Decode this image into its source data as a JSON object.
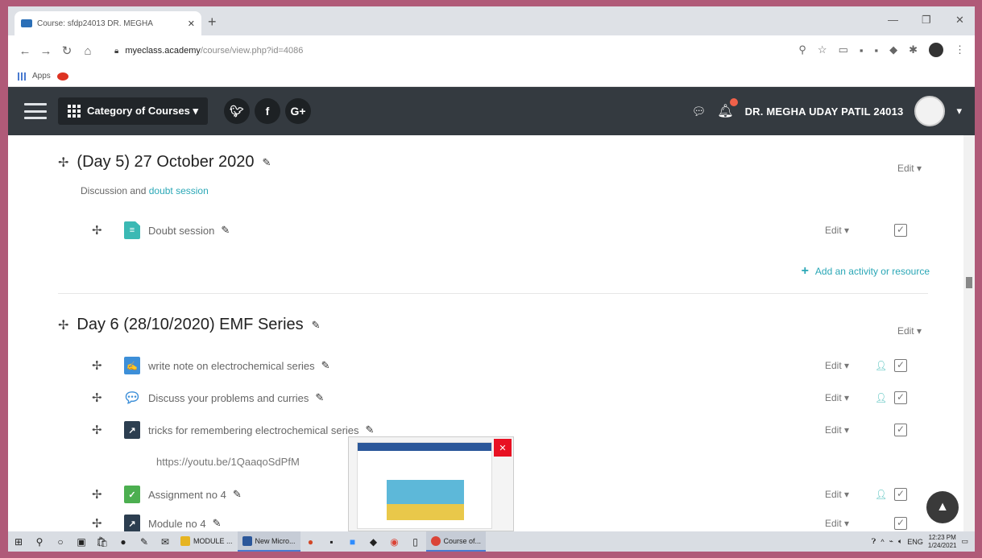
{
  "browser": {
    "tab_title": "Course: sfdp24013 DR. MEGHA",
    "url_host": "myeclass.academy",
    "url_path": "/course/view.php?id=4086",
    "bookmarks_apps": "Apps"
  },
  "navbar": {
    "category_menu": "Category of Courses ▾",
    "social": [
      "𝑲",
      "f",
      "G+"
    ],
    "username": "DR. MEGHA UDAY PATIL 24013"
  },
  "sections": [
    {
      "title": "(Day 5) 27 October 2020",
      "edit": "Edit ▾",
      "summary_text": "Discussion and ",
      "summary_link": "doubt session",
      "activities": [
        {
          "name": "Doubt session",
          "edit": "Edit ▾"
        }
      ],
      "add_activity": "Add an activity or resource"
    },
    {
      "title": "Day 6 (28/10/2020) EMF Series",
      "edit": "Edit ▾",
      "activities": [
        {
          "name": "write note on electrochemical series",
          "edit": "Edit ▾"
        },
        {
          "name": "Discuss your problems and curries",
          "edit": "Edit ▾"
        },
        {
          "name": "tricks for remembering electrochemical series",
          "edit": "Edit ▾",
          "url": "https://youtu.be/1QaaqoSdPfM"
        },
        {
          "name": "Assignment no 4",
          "edit": "Edit ▾"
        },
        {
          "name": "Module no 4",
          "edit": "Edit ▾"
        }
      ]
    }
  ],
  "taskbar": {
    "apps": [
      "MODULE ...",
      "New Micro...",
      "Course of..."
    ],
    "lang": "ENG",
    "time": "12:23 PM",
    "date": "1/24/2021"
  },
  "colors": {
    "navbar": "#343a40",
    "accent": "#2aa7b6",
    "frame": "#b05a78"
  }
}
